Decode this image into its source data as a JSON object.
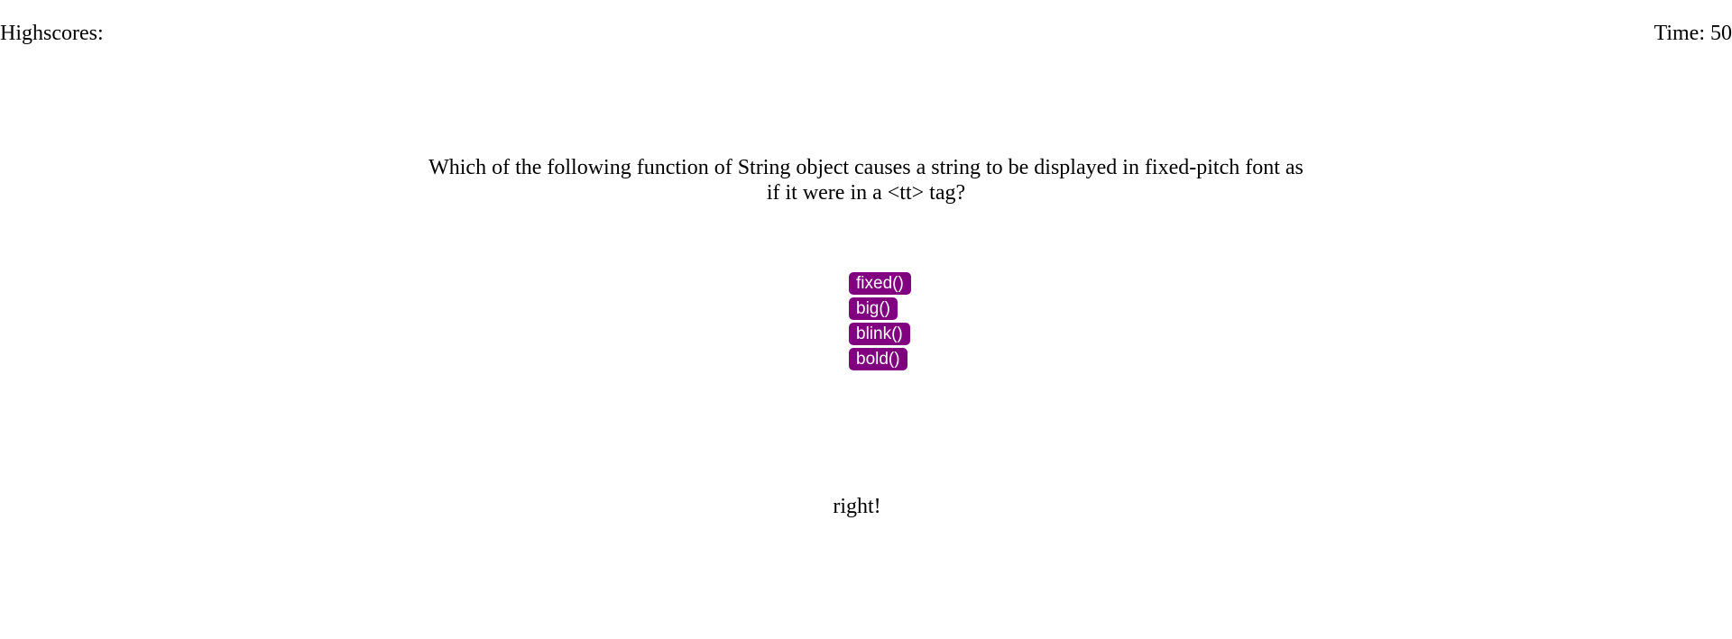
{
  "header": {
    "highscores_label": "Highscores:",
    "timer_text": "Time: 50"
  },
  "question": {
    "text": "Which of the following function of String object causes a string to be displayed in fixed-pitch font as if it were in a <tt> tag?"
  },
  "choices": [
    {
      "label": "fixed()"
    },
    {
      "label": "big()"
    },
    {
      "label": "blink()"
    },
    {
      "label": "bold()"
    }
  ],
  "feedback": {
    "text": "right!"
  },
  "colors": {
    "button_bg": "#800080",
    "button_text": "#ffffff",
    "page_bg": "#ffffff",
    "text": "#000000"
  }
}
